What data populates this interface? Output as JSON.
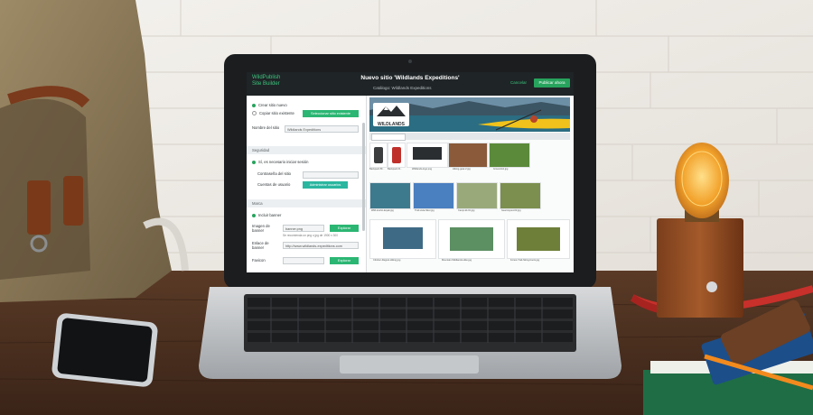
{
  "app": {
    "brand_line1": "WildPublish",
    "brand_line2": "Site Builder",
    "title": "Nuevo sitio 'Wildlands Expeditions'",
    "subtitle": "Catálogo: Wildlands Expeditions",
    "cancel_label": "Cancelar",
    "publish_label": "Publicar ahora"
  },
  "form": {
    "option_new": "Crear sitio nuevo",
    "option_existing": "Copiar sitio existente",
    "existing_dropdown": "Seleccionar sitio existente",
    "name_label": "Nombre del sitio",
    "name_value": "Wildlands Expeditions",
    "section_security": "Seguridad",
    "password_required": "Sí, es necesario iniciar sesión",
    "password_label": "Contraseña del sitio",
    "users_label": "Cuentas de usuario",
    "users_button": "Administrar usuarios",
    "section_banner": "Marca",
    "banner_toggle": "Incluir banner",
    "banner_image_label": "Imagen de banner",
    "banner_image_value": "banner.png",
    "banner_image_button": "Explorar",
    "banner_hint": "Se recomienda un png o jpg de 1900 x 300",
    "banner_link_label": "Enlace de banner",
    "banner_link_value": "http://www.wildlands-expeditions.com",
    "favicon_label": "Favicon",
    "favicon_button": "Explorar"
  },
  "gallery": {
    "hero_logo": "WILDLANDS",
    "captions_row1": [
      "Backpack Bl...",
      "Backpack R...",
      "Wildlands-logo.png",
      "Hiking-gear-2.jpg",
      "Ground-kit.jpg"
    ],
    "captions_row2": [
      "Wild-tourist-kayak.jpg",
      "Trail-vista-hiker.jpg",
      "Camp-kit-01.jpg",
      "Gear-layout-02.jpg"
    ],
    "captions_row3": [
      "Climber-Rappel-Hiking.jpg",
      "Mountain-Wildlands-Hike.jpg",
      "Forest-Trail-hiking-boots.jpg"
    ]
  },
  "colors": {
    "accent_green": "#27a35d",
    "topbar": "#1f2426",
    "lamp_glow": "#f3a52c",
    "cable_red": "#c8302b"
  }
}
